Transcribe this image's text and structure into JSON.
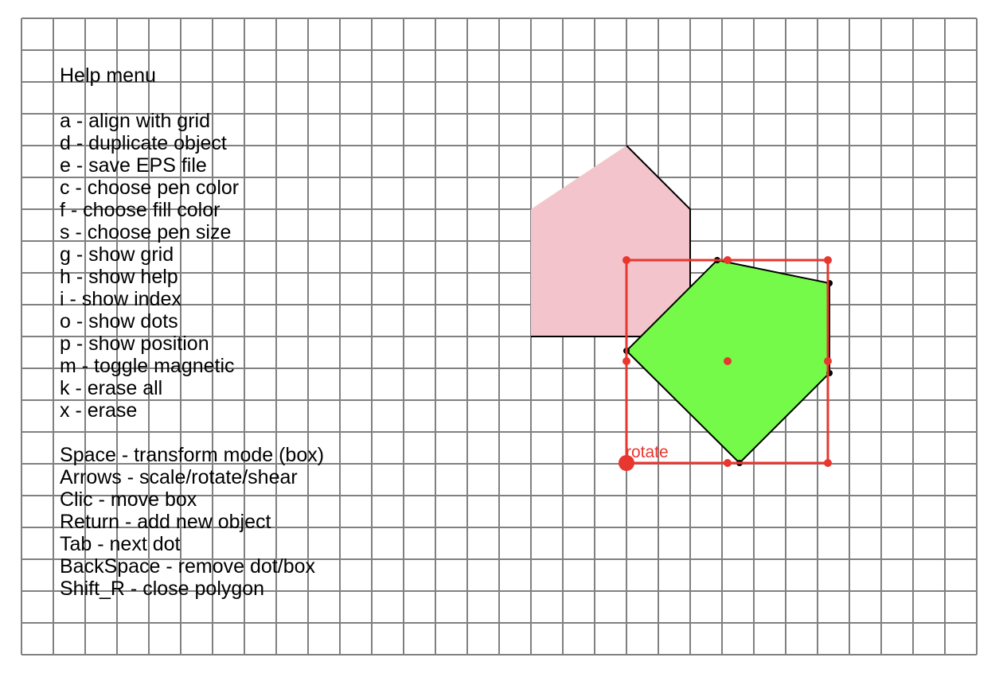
{
  "help_menu": {
    "title": "Help menu",
    "key_shortcuts": [
      "a - align with grid",
      "d - duplicate object",
      "e - save EPS file",
      "c - choose pen color",
      "f - choose fill color",
      "s - choose pen size",
      "g - show grid",
      "h - show help",
      "i - show index",
      "o - show dots",
      "p - show position",
      "m - toggle magnetic",
      "k - erase all",
      "x - erase"
    ],
    "transform_shortcuts": [
      "Space - transform mode (box)",
      "Arrows - scale/rotate/shear",
      "Clic - move box",
      "Return - add new object",
      "Tab - next dot",
      "BackSpace - remove dot/box",
      "Shift_R - close polygon"
    ]
  },
  "transform_box": {
    "mode_label": "rotate"
  },
  "colors": {
    "grid": "#808080",
    "pink_fill": "#f3c4cc",
    "green_fill": "#75fa49",
    "selection": "#e8372f",
    "text": "#000000"
  },
  "shapes": [
    {
      "name": "pink-pentagon",
      "fill": "pink_fill",
      "selected": false
    },
    {
      "name": "green-pentagon",
      "fill": "green_fill",
      "selected": true
    }
  ]
}
